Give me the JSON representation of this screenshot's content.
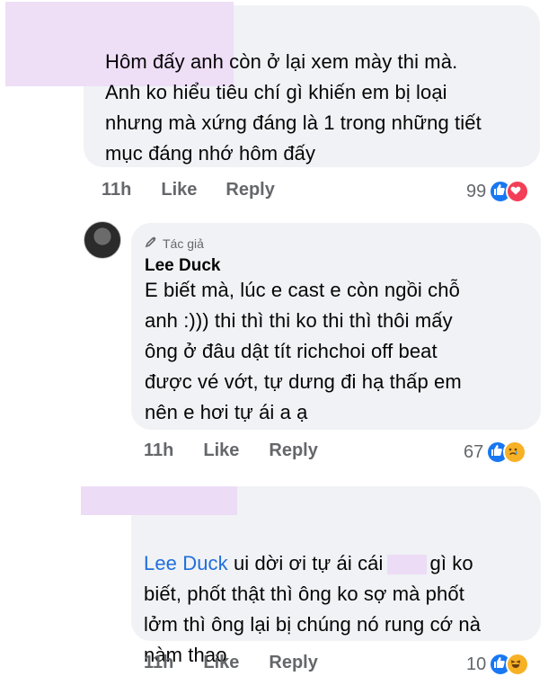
{
  "comments": [
    {
      "text": "Hôm đấy anh còn ở lại xem mày thi mà.\nAnh ko hiểu tiêu chí gì khiến em bị loại\nnhưng mà xứng đáng là 1 trong những tiết\nmục đáng nhớ hôm đấy",
      "time": "11h",
      "like": "Like",
      "reply": "Reply",
      "reactions": "99"
    },
    {
      "badge": "Tác giả",
      "author": "Lee Duck",
      "text": "E biết mà, lúc e cast e còn ngồi chỗ\nanh :))) thi thì thi ko thi thì thôi mấy\nông ở đâu dật tít richchoi off beat\nđược vé vớt, tự dưng đi hạ thấp em\nnên e hơi tự ái a ạ",
      "time": "11h",
      "like": "Like",
      "reply": "Reply",
      "reactions": "67"
    },
    {
      "mention": "Lee Duck",
      "text_a": " ui dời ơi tự ái cái",
      "text_b": "gì ko",
      "text_rest": "biết, phốt thật thì ông ko sợ mà phốt\nlởm thì ông lại bị chúng nó rung cớ nà\nnàm thao",
      "time": "11h",
      "like": "Like",
      "reply": "Reply",
      "reactions": "10"
    }
  ],
  "colors": {
    "bubble": "#f0f2f5",
    "meta": "#65676b",
    "mention": "#216fdb",
    "like_reaction": "#1877f2",
    "love_reaction": "#f33e58",
    "emoji_reaction": "#f7b125"
  }
}
